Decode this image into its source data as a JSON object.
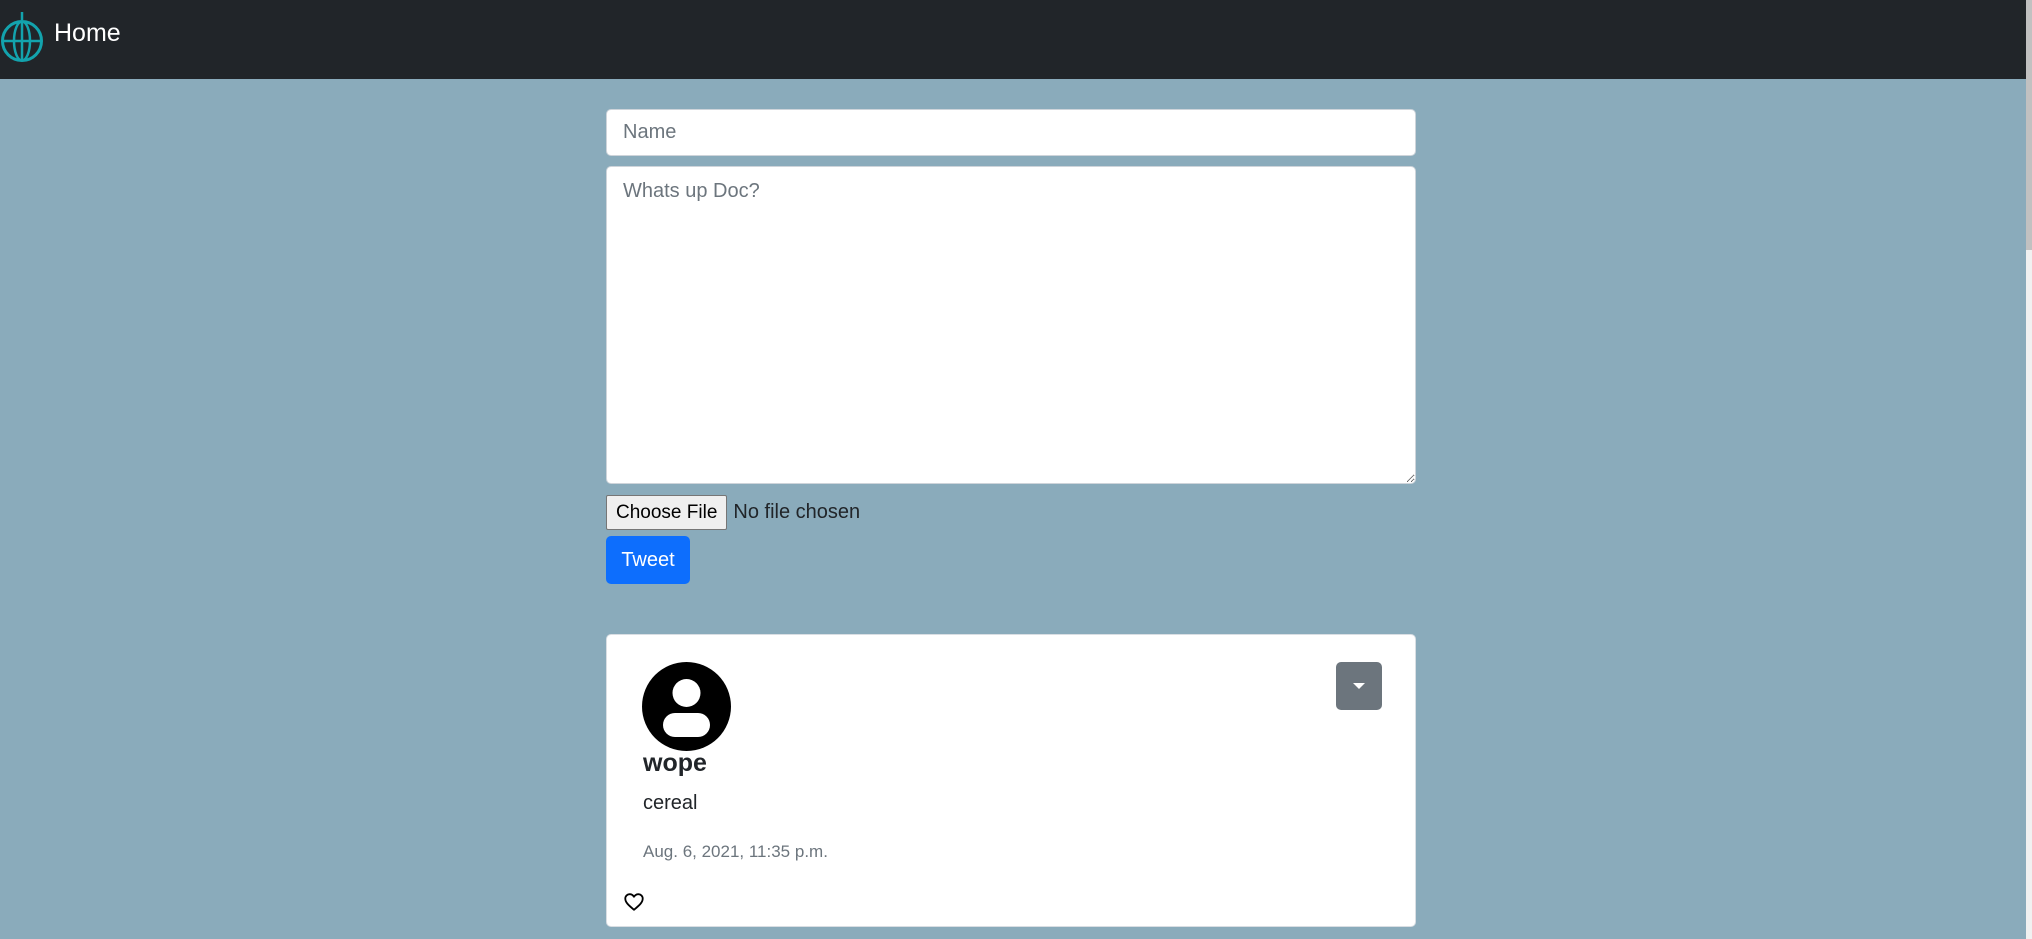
{
  "navbar": {
    "title": "Home",
    "logo_icon": "globe-icon",
    "logo_color": "#13a3ad",
    "background": "#212529"
  },
  "page": {
    "background": "#8aabbb"
  },
  "form": {
    "name_placeholder": "Name",
    "name_value": "",
    "message_placeholder": "Whats up Doc?",
    "message_value": "",
    "choose_file_label": "Choose File",
    "file_status": "No file chosen",
    "submit_label": "Tweet",
    "submit_color": "#0d6efd"
  },
  "tweets": [
    {
      "author": "wope",
      "text": "cereal",
      "timestamp": "Aug. 6, 2021, 11:35 p.m.",
      "avatar_icon": "user-circle-icon",
      "menu_icon": "caret-down-icon",
      "like_icon": "heart-outline-icon"
    }
  ]
}
